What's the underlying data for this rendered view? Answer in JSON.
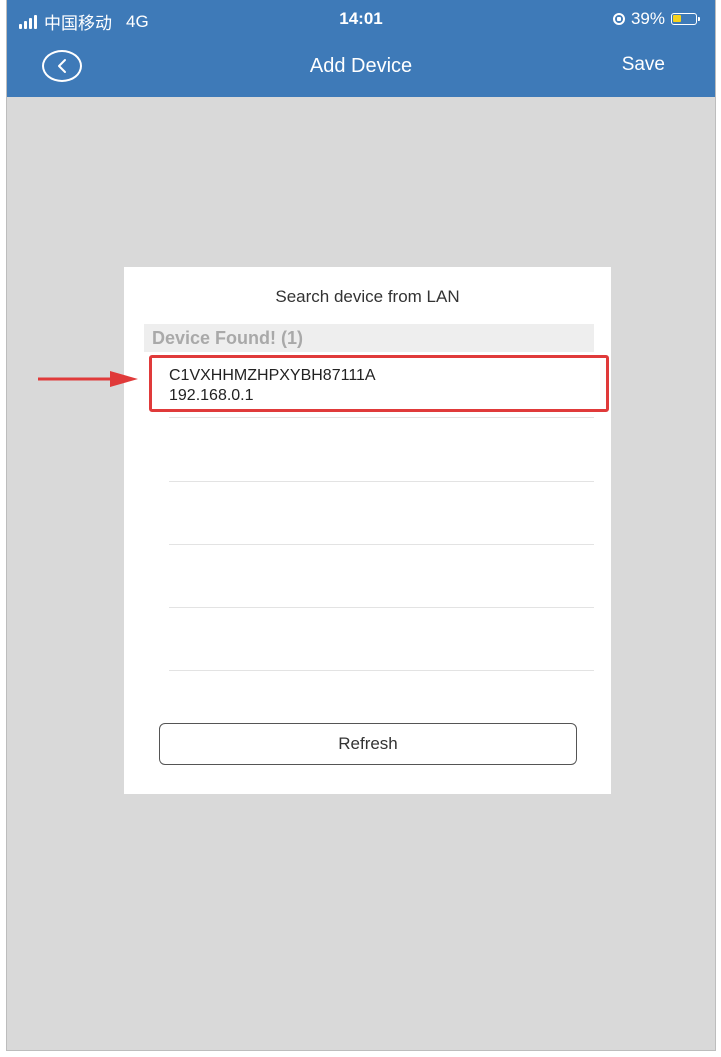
{
  "status_bar": {
    "carrier": "中国移动",
    "network": "4G",
    "time": "14:01",
    "battery_percent": "39%",
    "battery_level": 0.39,
    "icons": [
      "signal-bars-icon",
      "rotation-lock-icon",
      "battery-icon"
    ]
  },
  "navbar": {
    "title": "Add Device",
    "save_label": "Save",
    "back_icon": "chevron-left-icon"
  },
  "dialog": {
    "title": "Search device from LAN",
    "found_header": "Device Found! (1)",
    "devices": [
      {
        "id": "C1VXHHMZHPXYBH87111A",
        "ip": "192.168.0.1"
      }
    ],
    "refresh_label": "Refresh"
  },
  "colors": {
    "app_bar": "#3e7ab8",
    "highlight": "#e03a3a",
    "battery_fill": "#f6d21b",
    "background": "#d9d9d9"
  }
}
